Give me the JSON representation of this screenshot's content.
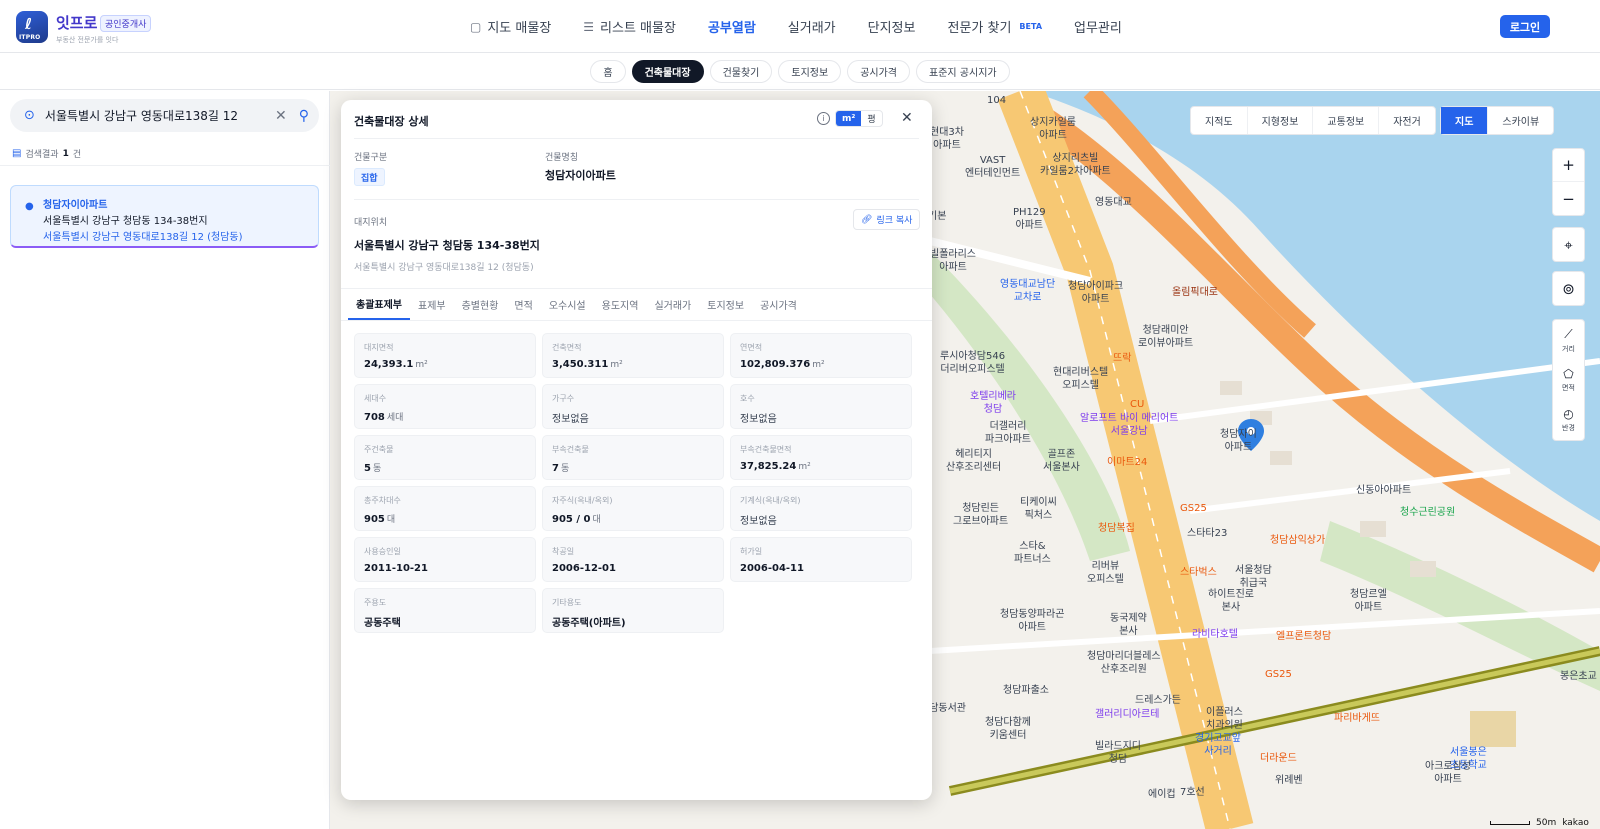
{
  "header": {
    "logo_text": "ITPRO",
    "brand": "잇프로",
    "badge": "공인중개사",
    "tagline": "부동산 전문가를 잇다",
    "nav": [
      {
        "label": "지도 매물장",
        "icon": "map-icon"
      },
      {
        "label": "리스트 매물장",
        "icon": "list-icon"
      },
      {
        "label": "공부열람",
        "active": true
      },
      {
        "label": "실거래가"
      },
      {
        "label": "단지정보"
      },
      {
        "label": "전문가 찾기",
        "badge": "BETA"
      },
      {
        "label": "업무관리"
      }
    ],
    "login_label": "로그인"
  },
  "subnav": [
    "홈",
    "건축물대장",
    "건물찾기",
    "토지정보",
    "공시가격",
    "표준지 공시지가"
  ],
  "subnav_active": "건축물대장",
  "sidebar": {
    "search_value": "서울특별시 강남구 영동대로138길 12",
    "result_prefix": "검색결과",
    "result_count": "1",
    "result_suffix": "건",
    "result": {
      "name": "청담자이아파트",
      "jibun": "서울특별시 강남구 청담동 134-38번지",
      "road": "서울특별시 강남구 영동대로138길 12 (청담동)"
    }
  },
  "map": {
    "layer_buttons": [
      "지적도",
      "지형정보",
      "교통정보",
      "자전거"
    ],
    "view_buttons": [
      "지도",
      "스카이뷰"
    ],
    "view_active": "지도",
    "zoom_in": "+",
    "zoom_out": "−",
    "tools": [
      "거리",
      "면적",
      "반경"
    ],
    "scale_label": "50m",
    "attribution": "kakao",
    "labels": [
      {
        "text": "104",
        "c": ""
      },
      {
        "text": "상지카일룸\n아파트",
        "c": ""
      },
      {
        "text": "현대3차\n아파트",
        "c": ""
      },
      {
        "text": "VAST\n엔터테인먼트",
        "c": ""
      },
      {
        "text": "상지리츠빌\n카일룸2차아파트",
        "c": ""
      },
      {
        "text": "영동대교",
        "c": ""
      },
      {
        "text": "기본",
        "c": ""
      },
      {
        "text": "PH129\n아파트",
        "c": ""
      },
      {
        "text": "빌폴라리스\n아파트",
        "c": ""
      },
      {
        "text": "영동대교남단\n교차로",
        "c": "blue"
      },
      {
        "text": "청담아이파크\n아파트",
        "c": ""
      },
      {
        "text": "올림픽대로",
        "c": "road"
      },
      {
        "text": "청담래미안\n로이뷰아파트",
        "c": ""
      },
      {
        "text": "루시아청담546\n더리버오피스텔",
        "c": ""
      },
      {
        "text": "뜨락",
        "c": "orange"
      },
      {
        "text": "현대리버스텔\n오피스텔",
        "c": ""
      },
      {
        "text": "호텔리베라\n청담",
        "c": "purple"
      },
      {
        "text": "알로프트 바이 메리어트\n서울강남",
        "c": "purple"
      },
      {
        "text": "CU",
        "c": "orange"
      },
      {
        "text": "더갤러리\n파크아파트",
        "c": ""
      },
      {
        "text": "청담자이\n아파트",
        "c": ""
      },
      {
        "text": "헤리티지\n산후조리센터",
        "c": ""
      },
      {
        "text": "골프존\n서울본사",
        "c": ""
      },
      {
        "text": "이마트24",
        "c": "orange"
      },
      {
        "text": "신동아아파트",
        "c": ""
      },
      {
        "text": "티케이씨\n픽처스",
        "c": ""
      },
      {
        "text": "GS25",
        "c": "orange"
      },
      {
        "text": "청수근린공원",
        "c": "green"
      },
      {
        "text": "청담린든\n그로브아파트",
        "c": ""
      },
      {
        "text": "청담복집",
        "c": "orange"
      },
      {
        "text": "스타&\n파트너스",
        "c": ""
      },
      {
        "text": "스타타23",
        "c": ""
      },
      {
        "text": "청담삼익상가",
        "c": "orange"
      },
      {
        "text": "리버뷰\n오피스텔",
        "c": ""
      },
      {
        "text": "스타벅스",
        "c": "orange"
      },
      {
        "text": "서울청담\n취급국",
        "c": ""
      },
      {
        "text": "하이트진로\n본사",
        "c": ""
      },
      {
        "text": "청담르엘\n아파트",
        "c": ""
      },
      {
        "text": "청담동양파라곤\n아파트",
        "c": ""
      },
      {
        "text": "동국제약\n본사",
        "c": ""
      },
      {
        "text": "라비타호텔",
        "c": "purple"
      },
      {
        "text": "엘프론트청담",
        "c": "orange"
      },
      {
        "text": "청담마리더블레스\n산후조리원",
        "c": ""
      },
      {
        "text": "GS25",
        "c": "orange"
      },
      {
        "text": "청담파출소",
        "c": ""
      },
      {
        "text": "드레스가든",
        "c": ""
      },
      {
        "text": "봉은초교",
        "c": ""
      },
      {
        "text": "청담다함께\n키움센터",
        "c": ""
      },
      {
        "text": "갤러리디아르테",
        "c": "purple"
      },
      {
        "text": "이플러스\n치과의원",
        "c": ""
      },
      {
        "text": "파리바게뜨",
        "c": "orange"
      },
      {
        "text": "경기고교앞\n사거리",
        "c": "blue"
      },
      {
        "text": "더라운드",
        "c": "orange"
      },
      {
        "text": "서울봉은\n초등학교",
        "c": "blue"
      },
      {
        "text": "빌라드지디\n청담",
        "c": ""
      },
      {
        "text": "아크로삼성\n아파트",
        "c": ""
      },
      {
        "text": "위례벤",
        "c": ""
      },
      {
        "text": "에이컵",
        "c": ""
      },
      {
        "text": "7호선",
        "c": ""
      },
      {
        "text": "청담동서관",
        "c": ""
      }
    ]
  },
  "panel": {
    "title": "건축물대장 상세",
    "unit_m2": "m²",
    "unit_pyeong": "평",
    "building_type_label": "건물구분",
    "building_type": "집합",
    "building_name_label": "건물명칭",
    "building_name": "청담자이아파트",
    "location_label": "대지위치",
    "copy_label": "링크 복사",
    "address_jibun": "서울특별시 강남구 청담동 134-38번지",
    "address_road": "서울특별시 강남구 영동대로138길 12 (청담동)",
    "tabs": [
      "총괄표제부",
      "표제부",
      "층별현황",
      "면적",
      "오수시설",
      "용도지역",
      "실거래가",
      "토지정보",
      "공시가격"
    ],
    "active_tab": "총괄표제부",
    "fields": [
      {
        "label": "대지면적",
        "value": "24,393.1",
        "unit": "m²"
      },
      {
        "label": "건축면적",
        "value": "3,450.311",
        "unit": "m²"
      },
      {
        "label": "연면적",
        "value": "102,809.376",
        "unit": "m²"
      },
      {
        "label": "세대수",
        "value": "708",
        "unit": "세대"
      },
      {
        "label": "가구수",
        "value": "정보없음",
        "unit": ""
      },
      {
        "label": "호수",
        "value": "정보없음",
        "unit": ""
      },
      {
        "label": "주건축물",
        "value": "5",
        "unit": "동"
      },
      {
        "label": "부속건축물",
        "value": "7",
        "unit": "동"
      },
      {
        "label": "부속건축물면적",
        "value": "37,825.24",
        "unit": "m²"
      },
      {
        "label": "총주차대수",
        "value": "905",
        "unit": "대"
      },
      {
        "label": "자주식(옥내/옥외)",
        "value": "905 / 0",
        "unit": "대"
      },
      {
        "label": "기계식(옥내/옥외)",
        "value": "정보없음",
        "unit": ""
      },
      {
        "label": "사용승인일",
        "value": "2011-10-21",
        "unit": ""
      },
      {
        "label": "착공일",
        "value": "2006-12-01",
        "unit": ""
      },
      {
        "label": "허가일",
        "value": "2006-04-11",
        "unit": ""
      },
      {
        "label": "주용도",
        "value": "공동주택",
        "unit": ""
      },
      {
        "label": "기타용도",
        "value": "공동주택(아파트)",
        "unit": ""
      }
    ]
  },
  "colors": {
    "accent": "#2563eb",
    "brand": "#4338ca",
    "road_major": "#f7c873",
    "road_highway": "#f4a259",
    "river": "#a9d4ee",
    "park": "#d4e7c5"
  }
}
